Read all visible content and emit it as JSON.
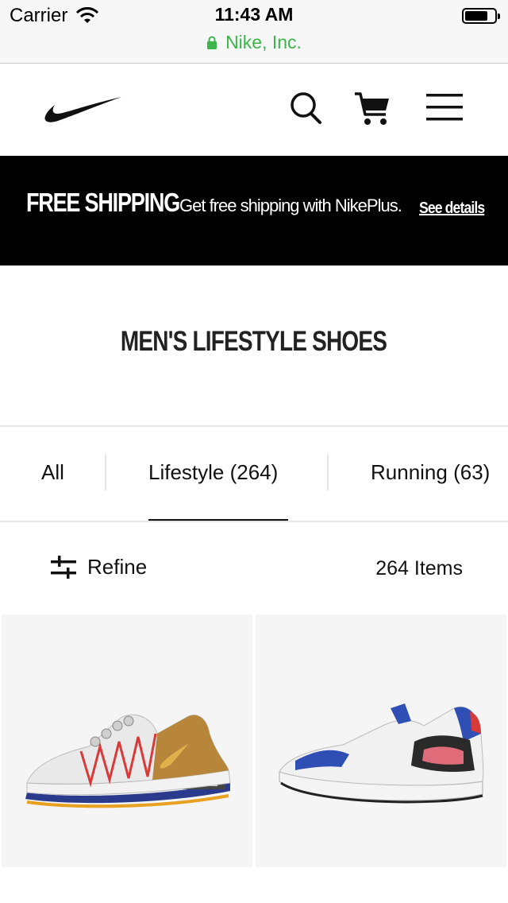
{
  "status_bar": {
    "carrier": "Carrier",
    "time": "11:43 AM",
    "site": "Nike, Inc.",
    "site_color": "#3bb54a"
  },
  "header": {
    "logo": "nike-swoosh",
    "icons": [
      "search-icon",
      "cart-icon",
      "menu-icon"
    ]
  },
  "promo": {
    "title": "FREE SHIPPING",
    "text": "Get free shipping with NikePlus.",
    "link": "See details"
  },
  "page_title": "MEN'S LIFESTYLE SHOES",
  "tabs": [
    {
      "label": "All"
    },
    {
      "label": "Lifestyle (264)",
      "selected": true
    },
    {
      "label": "Running (63)"
    }
  ],
  "filter": {
    "refine_label": "Refine",
    "item_count": "264 Items"
  },
  "products": [
    {
      "name": "lifestyle shoe white-red-gold"
    },
    {
      "name": "lifestyle shoe white-blue-pink"
    }
  ]
}
